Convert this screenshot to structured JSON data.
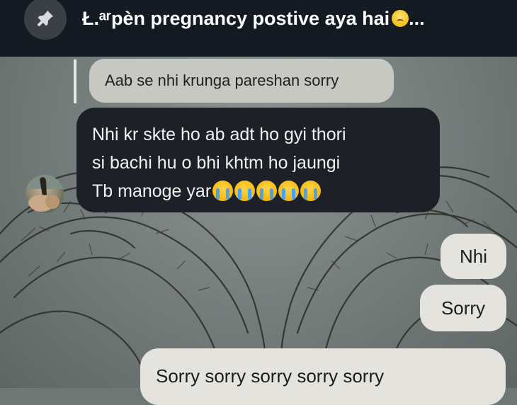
{
  "pinned": {
    "text": "Ł.ᵃʳpèn pregnancy postive aya hai",
    "emoji": "pleading-face",
    "ellipsis": "..."
  },
  "messages": {
    "quoted_reply": "Aab se nhi krunga pareshan sorry",
    "received": {
      "lines": [
        "Nhi kr skte ho ab adt ho gyi thori",
        "si bachi hu o bhi khtm ho jaungi",
        "Tb manoge yar"
      ],
      "emoji": "loudly-crying-face",
      "emoji_count": 5
    },
    "sent_1": "Nhi",
    "sent_2": "Sorry",
    "sent_3": "Sorry sorry sorry sorry sorry"
  },
  "colors": {
    "header_bg": "#141a22",
    "received_bubble": "#1d2127",
    "sent_bubble": "#e5e3de",
    "quoted_bubble": "#c8c8c3"
  }
}
